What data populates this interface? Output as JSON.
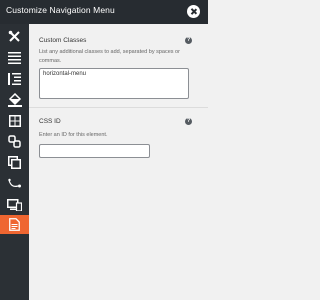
{
  "header": {
    "title": "Customize Navigation Menu"
  },
  "sidebar": {
    "items": [
      {
        "icon": "wrench-screwdriver-icon"
      },
      {
        "icon": "align-justify-icon"
      },
      {
        "icon": "indent-icon"
      },
      {
        "icon": "paint-bucket-icon"
      },
      {
        "icon": "border-grid-icon"
      },
      {
        "icon": "link-chain-icon"
      },
      {
        "icon": "layers-copy-icon"
      },
      {
        "icon": "motion-path-icon"
      },
      {
        "icon": "responsive-devices-icon"
      },
      {
        "icon": "document-code-icon",
        "active": true
      }
    ],
    "active_color": "#ef6631"
  },
  "custom_classes": {
    "title": "Custom Classes",
    "description": "List any additional classes to add, separated by spaces or commas.",
    "value": "horizontal-menu"
  },
  "css_id": {
    "title": "CSS ID",
    "description": "Enter an ID for this element.",
    "value": ""
  },
  "help_glyph": "?"
}
